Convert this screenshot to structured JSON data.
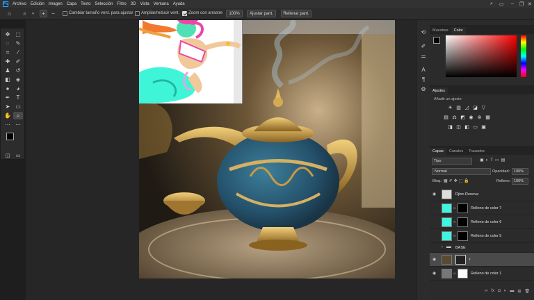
{
  "menu": {
    "app_logo": "Ps",
    "items": [
      "Archivo",
      "Edición",
      "Imagen",
      "Capa",
      "Texto",
      "Selección",
      "Filtro",
      "3D",
      "Vista",
      "Ventana",
      "Ayuda"
    ]
  },
  "options": {
    "resize_windows_label": "Cambiar tamaño vent. para ajustar",
    "zoom_all_label": "Ampliar/reducir vent.",
    "scrubby_zoom_label": "Zoom con arrastre",
    "zoom_value": "100%",
    "fit_screen_label": "Ajustar pant.",
    "fill_screen_label": "Rellenar pant."
  },
  "color_panel": {
    "tabs": [
      "Muestras",
      "Color"
    ],
    "active_tab": "Color"
  },
  "adjustments": {
    "title": "Ajustes",
    "subtitle": "Añadir un ajuste"
  },
  "layers": {
    "tabs": [
      "Capas",
      "Canales",
      "Trazados"
    ],
    "filter": "Tipo",
    "blend_mode": "Normal",
    "opacity_label": "Opacidad:",
    "opacity_value": "100%",
    "lock_label": "Bloq.:",
    "fill_label": "Relleno:",
    "fill_value": "100%",
    "items": [
      {
        "name": "Djinn Renova",
        "visible": true
      },
      {
        "name": "Relleno de color 7",
        "visible": false
      },
      {
        "name": "Relleno de color 6",
        "visible": false
      },
      {
        "name": "Relleno de color 5",
        "visible": false
      },
      {
        "name": "BASE",
        "visible": false
      },
      {
        "name": "r",
        "visible": true
      },
      {
        "name": "Relleno de color 1",
        "visible": true
      }
    ]
  },
  "colors": {
    "accent": "#31a8ff",
    "fill_thumb": "#3ff5e0",
    "bg": "#2b2b2b"
  }
}
